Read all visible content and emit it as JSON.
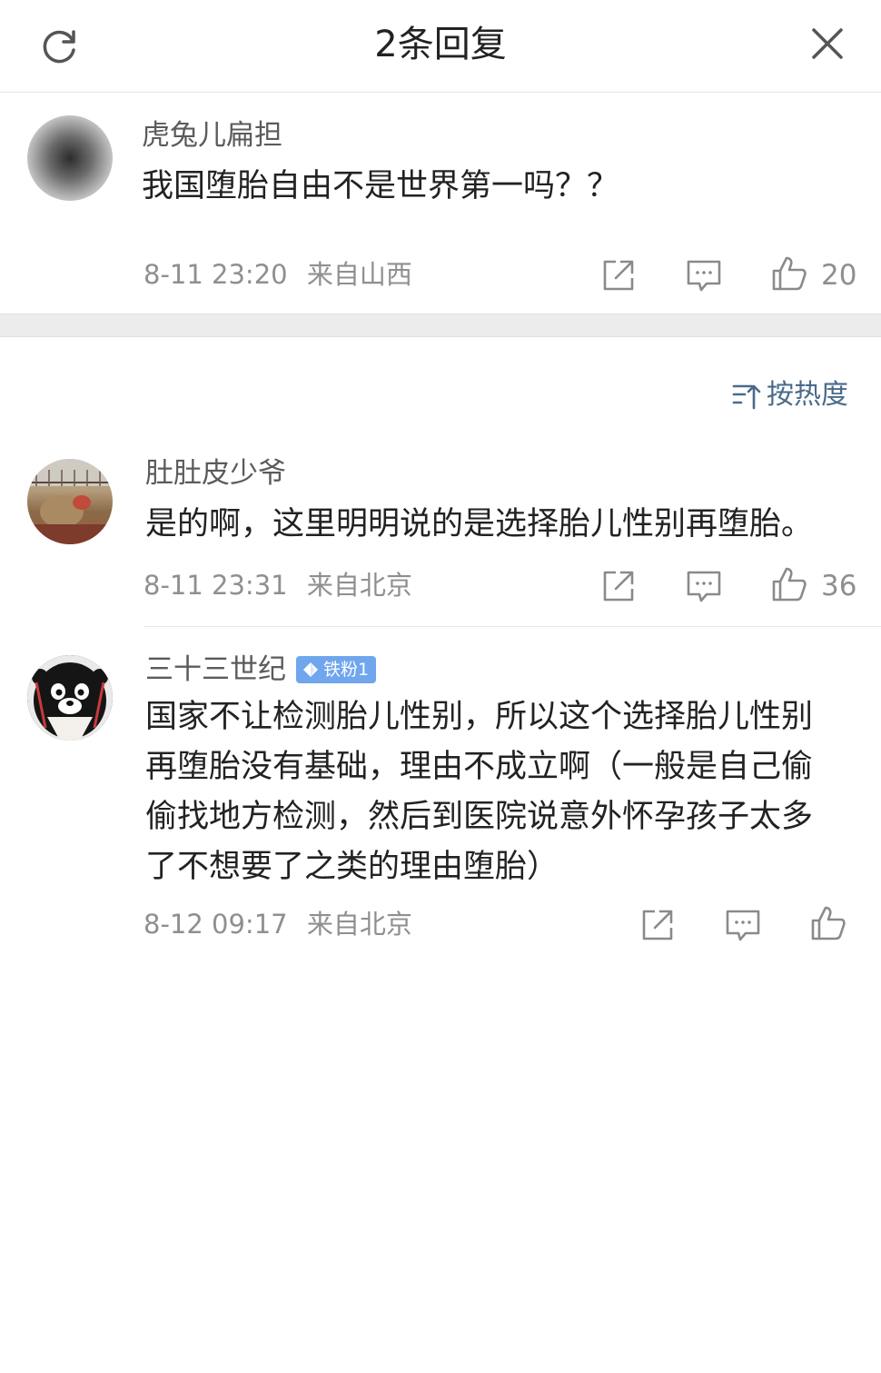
{
  "header": {
    "title": "2条回复",
    "refresh_icon": "refresh-icon",
    "close_icon": "close-icon"
  },
  "main_comment": {
    "author": "虎兔儿扁担",
    "text": "我国堕胎自由不是世界第一吗？？",
    "time": "8-11 23:20",
    "location": "来自山西",
    "likes": "20"
  },
  "sort": {
    "label": "按热度",
    "icon": "sort-icon"
  },
  "replies": [
    {
      "author": "肚肚皮少爷",
      "text_lines": [
        "是的啊，这里明明说的是选择胎儿性别再堕胎。"
      ],
      "time": "8-11 23:31",
      "location": "来自北京",
      "likes": "36"
    },
    {
      "author": "三十三世纪",
      "badge": "铁粉1",
      "text_lines": [
        "国家不让检测胎儿性别，所以这个选择胎儿性别",
        "再堕胎没有基础，理由不成立啊（一般是自己偷",
        "偷找地方检测，然后到医院说意外怀孕孩子太多",
        "了不想要了之类的理由堕胎）"
      ],
      "time": "8-12 09:17",
      "location": "来自北京",
      "likes": ""
    }
  ],
  "colors": {
    "link": "#4a6a8a",
    "badge": "#6fa6ee",
    "meta": "#8f8f8f",
    "divider": "#ececec"
  }
}
